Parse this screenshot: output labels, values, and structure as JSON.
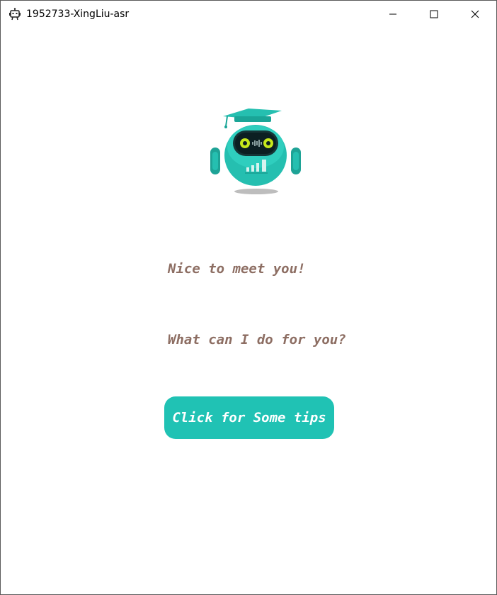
{
  "window": {
    "title": "1952733-XingLiu-asr",
    "app_icon": "robot-icon",
    "controls": {
      "minimize": "minimize-icon",
      "maximize": "maximize-icon",
      "close": "close-icon"
    }
  },
  "main": {
    "mascot": "robot-graduate-icon",
    "greeting": "Nice to meet you!",
    "question": "What can I do for you?",
    "tips_button": "Click for Some tips"
  },
  "colors": {
    "accent": "#20c2b4",
    "message_text": "#8d6e63",
    "robot_eyes": "#c6e81c"
  }
}
